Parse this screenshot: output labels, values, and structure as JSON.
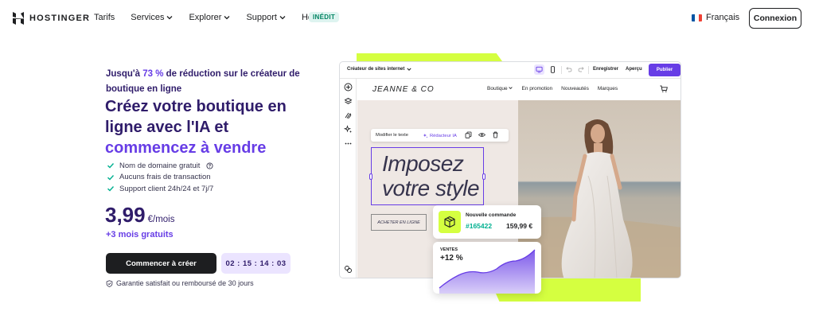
{
  "nav": {
    "logo": "HOSTINGER",
    "links": [
      {
        "label": "Tarifs",
        "has_dropdown": false
      },
      {
        "label": "Services",
        "has_dropdown": true
      },
      {
        "label": "Explorer",
        "has_dropdown": true
      },
      {
        "label": "Support",
        "has_dropdown": true
      },
      {
        "label": "Horizons",
        "has_dropdown": false
      }
    ],
    "horizons_badge": "INÉDIT",
    "language": "Français",
    "login": "Connexion"
  },
  "hero": {
    "promo_prefix": "Jusqu'à ",
    "promo_percent": "73 %",
    "promo_suffix": " de réduction sur le créateur de boutique en ligne",
    "headline_main": "Créez votre boutique en ligne avec l'IA et",
    "headline_accent": "commencez à vendre",
    "features": [
      "Nom de domaine gratuit",
      "Aucuns frais de transaction",
      "Support client 24h/24 et 7j/7"
    ],
    "price": "3,99",
    "price_unit": "€/mois",
    "bonus": "+3 mois gratuits",
    "cta": "Commencer à créer",
    "timer": "02 : 15 : 14 : 03",
    "guarantee": "Garantie satisfait ou remboursé de 30 jours"
  },
  "builder": {
    "site_type": "Créateur de sites internet",
    "save": "Enregistrer",
    "preview": "Aperçu",
    "publish": "Publier",
    "site_brand": "JEANNE & CO",
    "site_menu": [
      "Boutique",
      "En promotion",
      "Nouveautés",
      "Marques"
    ],
    "edit_text": "Modifier le texte",
    "ai_writer": "Rédacteur IA",
    "site_headline_line1": "Imposez",
    "site_headline_line2": "votre style",
    "buy_button": "ACHETER EN LIGNE"
  },
  "order_card": {
    "title": "Nouvelle commande",
    "order_id": "#165422",
    "amount": "159,99 €"
  },
  "sales_card": {
    "label": "VENTES",
    "value": "+12 %"
  },
  "colors": {
    "accent": "#673de6",
    "dark_purple": "#2f1c6a",
    "lime": "#d5ff40",
    "green": "#00b090"
  }
}
